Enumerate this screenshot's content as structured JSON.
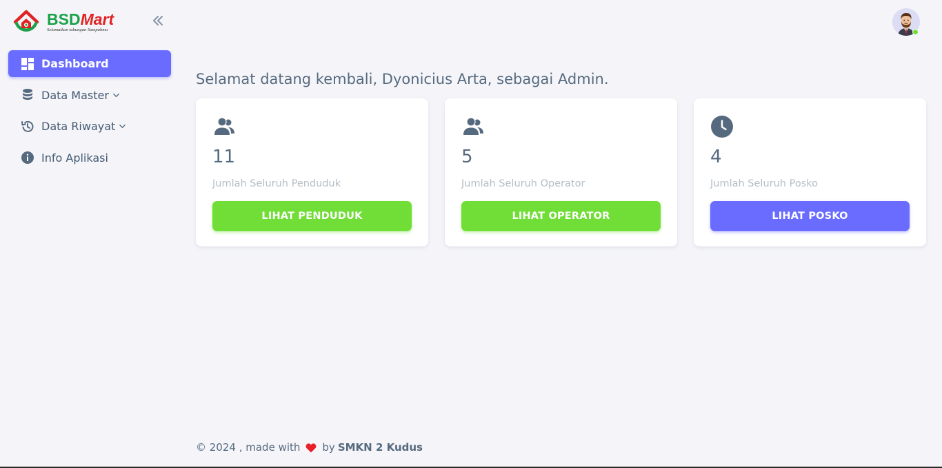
{
  "brand": {
    "name_part1": "BSD",
    "name_part2": "Mart",
    "tagline": "Selamatkan tabungan Sampahmu"
  },
  "sidebar": {
    "items": [
      {
        "label": "Dashboard",
        "icon": "dashboard-icon",
        "active": true,
        "has_caret": false
      },
      {
        "label": "Data Master",
        "icon": "database-icon",
        "active": false,
        "has_caret": true
      },
      {
        "label": "Data Riwayat",
        "icon": "history-icon",
        "active": false,
        "has_caret": true
      },
      {
        "label": "Info Aplikasi",
        "icon": "info-icon",
        "active": false,
        "has_caret": false
      }
    ]
  },
  "header": {
    "welcome": "Selamat datang kembali, Dyonicius Arta, sebagai Admin."
  },
  "cards": [
    {
      "icon": "users-icon",
      "value": "11",
      "label": "Jumlah Seluruh Penduduk",
      "button": "LIHAT PENDUDUK",
      "button_color": "#71dd37"
    },
    {
      "icon": "users-icon",
      "value": "5",
      "label": "Jumlah Seluruh Operator",
      "button": "LIHAT OPERATOR",
      "button_color": "#71dd37"
    },
    {
      "icon": "clock-icon",
      "value": "4",
      "label": "Jumlah Seluruh Posko",
      "button": "LIHAT POSKO",
      "button_color": "#696cff"
    }
  ],
  "footer": {
    "prefix": "© 2024 , made with",
    "by": "by",
    "org": "SMKN 2 Kudus"
  },
  "colors": {
    "primary": "#696cff",
    "success": "#71dd37",
    "background": "#f5f5f9",
    "text": "#566a7f",
    "muted": "#b4bdc6"
  }
}
